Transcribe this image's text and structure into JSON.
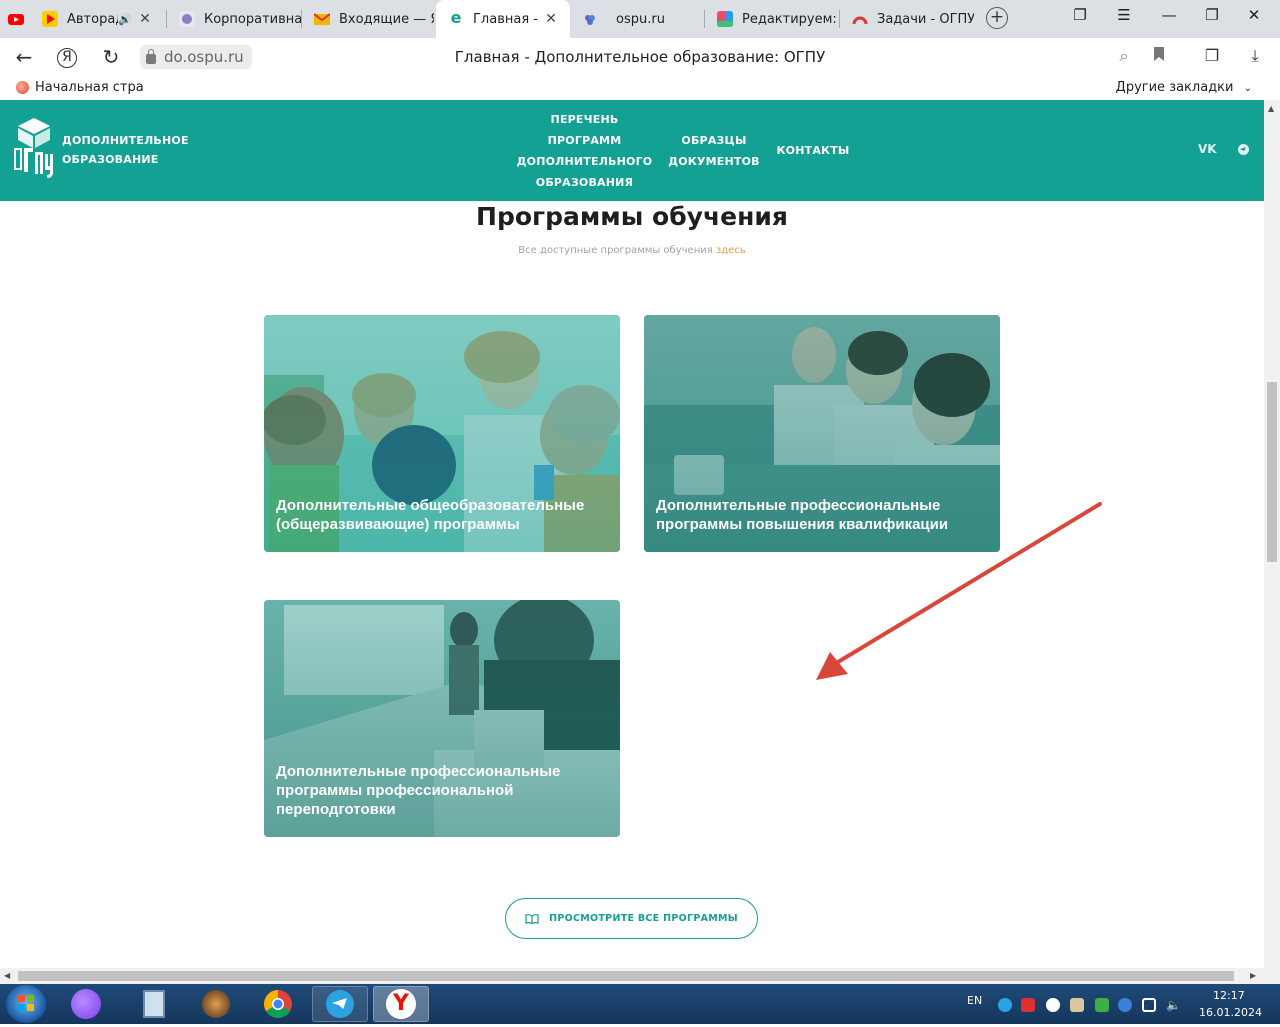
{
  "browser": {
    "tabs": [
      {
        "title": "Авторади",
        "favicon": "yandex-music-icon",
        "color": "#ffcc00",
        "audio": true
      },
      {
        "title": "Корпоративна",
        "favicon": "ogpu-crest-icon",
        "color": "#8a7fc0"
      },
      {
        "title": "Входящие — Я",
        "favicon": "yandex-mail-icon",
        "color": "#f4b400"
      },
      {
        "title": "Главная - До",
        "favicon": "e-icon",
        "color": "#13a193",
        "active": true
      },
      {
        "title": "ospu.ru",
        "favicon": "grape-icon",
        "color": "#6b5bd6"
      },
      {
        "title": "Редактируем: Д",
        "favicon": "editor-icon",
        "color": "#2f9ae0"
      },
      {
        "title": "Задачи - ОГПУ",
        "favicon": "tasks-icon",
        "color": "#d23c3c"
      }
    ],
    "url": "do.ospu.ru",
    "page_title": "Главная - Дополнительное образование: ОГПУ",
    "bookmarks": {
      "home": "Начальная страница",
      "other": "Другие закладки"
    }
  },
  "site": {
    "logo_text_line1": "ДОПОЛНИТЕЛЬНОЕ",
    "logo_text_line2": "ОБРАЗОВАНИЕ",
    "nav": [
      {
        "line1": "ПЕРЕЧЕНЬ ПРОГРАММ",
        "line2": "ДОПОЛНИТЕЛЬНОГО",
        "line3": "ОБРАЗОВАНИЯ"
      },
      {
        "line1": "ОБРАЗЦЫ",
        "line2": "ДОКУМЕНТОВ"
      },
      {
        "line1": "КОНТАКТЫ"
      }
    ],
    "social_vk": "VK"
  },
  "section": {
    "title": "Программы обучения",
    "subtitle": "Все доступные программы обучения",
    "subtitle_link": "здесь",
    "cards": [
      {
        "title": "Дополнительные общеобразовательные (общеразвивающие) программы"
      },
      {
        "title": "Дополнительные профессиональные программы повышения квалификации"
      },
      {
        "title": "Дополнительные профессиональные программы профессиональной переподготовки"
      }
    ],
    "all_button": "ПРОСМОТРИТЕ ВСЕ ПРОГРАММЫ"
  },
  "taskbar": {
    "lang": "EN",
    "time": "12:17",
    "date": "16.01.2024"
  },
  "colors": {
    "brand": "#13a193",
    "accent_link": "#e0a04a",
    "annotation_arrow": "#d9463a"
  }
}
